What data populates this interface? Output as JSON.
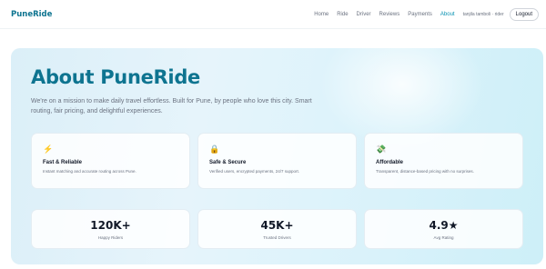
{
  "header": {
    "brand": "PuneRide",
    "nav": [
      "Home",
      "Ride",
      "Driver",
      "Reviews",
      "Payments",
      "About"
    ],
    "active_nav": "About",
    "user": "tanjila tamboli · rider",
    "logout_label": "Logout"
  },
  "hero": {
    "title": "About PuneRide",
    "description": "We're on a mission to make daily travel effortless. Built for Pune, by people who love this city. Smart routing, fair pricing, and delightful experiences."
  },
  "features": [
    {
      "icon": "lightning-bolt-icon",
      "glyph": "⚡",
      "color": "#f97316",
      "title": "Fast & Reliable",
      "desc": "Instant matching and accurate routing across Pune."
    },
    {
      "icon": "lock-icon",
      "glyph": "🔒",
      "color": "#f59e0b",
      "title": "Safe & Secure",
      "desc": "Verified users, encrypted payments, 24/7 support."
    },
    {
      "icon": "money-icon",
      "glyph": "💸",
      "color": "#16a34a",
      "title": "Affordable",
      "desc": "Transparent, distance-based pricing with no surprises."
    }
  ],
  "stats": [
    {
      "value": "120K+",
      "label": "Happy Riders"
    },
    {
      "value": "45K+",
      "label": "Trusted Drivers"
    },
    {
      "value": "4.9★",
      "label": "Avg Rating"
    }
  ],
  "colors": {
    "accent": "#0891b2",
    "brand": "#0e7490"
  }
}
